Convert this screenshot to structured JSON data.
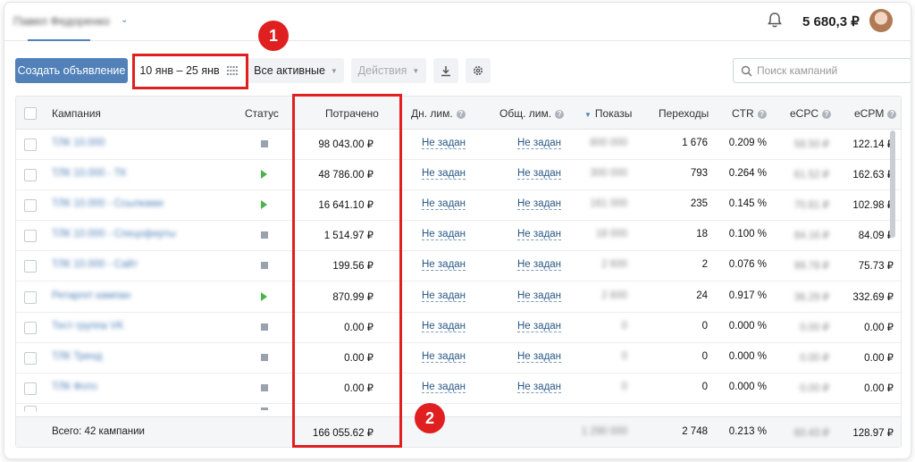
{
  "header": {
    "account_name": "Павел Федоренко",
    "balance": "5 680,3 ₽"
  },
  "toolbar": {
    "create_label": "Создать объявление",
    "date_range": "10 янв – 25 янв",
    "filter_label": "Все активные",
    "actions_label": "Действия",
    "search_placeholder": "Поиск кампаний"
  },
  "table": {
    "columns": {
      "campaign": "Кампания",
      "status": "Статус",
      "spent": "Потрачено",
      "daily_limit": "Дн. лим.",
      "total_limit": "Общ. лим.",
      "impressions": "Показы",
      "clicks": "Переходы",
      "ctr": "CTR",
      "ecpc": "eCPC",
      "ecpm": "eCPM"
    },
    "rows": [
      {
        "name": "ТЛК 10.000",
        "status": "paused",
        "spent": "98 043.00 ₽",
        "daily": "Не задан",
        "total": "Не задан",
        "impressions": "800 000",
        "clicks": "1 676",
        "ctr": "0.209 %",
        "ecpc": "58.50 ₽",
        "ecpm": "122.14 ₽"
      },
      {
        "name": "ТЛК 10.000 - ТК",
        "status": "active",
        "spent": "48 786.00 ₽",
        "daily": "Не задан",
        "total": "Не задан",
        "impressions": "300 000",
        "clicks": "793",
        "ctr": "0.264 %",
        "ecpc": "61.52 ₽",
        "ecpm": "162.63 ₽"
      },
      {
        "name": "ТЛК 10.000 - Ссылками",
        "status": "active",
        "spent": "16 641.10 ₽",
        "daily": "Не задан",
        "total": "Не задан",
        "impressions": "161 000",
        "clicks": "235",
        "ctr": "0.145 %",
        "ecpc": "70.81 ₽",
        "ecpm": "102.98 ₽"
      },
      {
        "name": "ТЛК 10.000 - Спецоферты",
        "status": "paused",
        "spent": "1 514.97 ₽",
        "daily": "Не задан",
        "total": "Не задан",
        "impressions": "18 000",
        "clicks": "18",
        "ctr": "0.100 %",
        "ecpc": "84.16 ₽",
        "ecpm": "84.09 ₽"
      },
      {
        "name": "ТЛК 10.000 - Сайт",
        "status": "paused",
        "spent": "199.56 ₽",
        "daily": "Не задан",
        "total": "Не задан",
        "impressions": "2 600",
        "clicks": "2",
        "ctr": "0.076 %",
        "ecpc": "99.78 ₽",
        "ecpm": "75.73 ₽"
      },
      {
        "name": "Ретаргет кампан",
        "status": "active",
        "spent": "870.99 ₽",
        "daily": "Не задан",
        "total": "Не задан",
        "impressions": "2 600",
        "clicks": "24",
        "ctr": "0.917 %",
        "ecpc": "36.29 ₽",
        "ecpm": "332.69 ₽"
      },
      {
        "name": "Тест группа VK",
        "status": "paused",
        "spent": "0.00 ₽",
        "daily": "Не задан",
        "total": "Не задан",
        "impressions": "0",
        "clicks": "0",
        "ctr": "0.000 %",
        "ecpc": "0.00 ₽",
        "ecpm": "0.00 ₽"
      },
      {
        "name": "ТЛК Тренд",
        "status": "paused",
        "spent": "0.00 ₽",
        "daily": "Не задан",
        "total": "Не задан",
        "impressions": "0",
        "clicks": "0",
        "ctr": "0.000 %",
        "ecpc": "0.00 ₽",
        "ecpm": "0.00 ₽"
      },
      {
        "name": "ТЛК Фото",
        "status": "paused",
        "spent": "0.00 ₽",
        "daily": "Не задан",
        "total": "Не задан",
        "impressions": "0",
        "clicks": "0",
        "ctr": "0.000 %",
        "ecpc": "0.00 ₽",
        "ecpm": "0.00 ₽"
      }
    ],
    "footer": {
      "label": "Всего: 42 кампании",
      "spent": "166 055.62 ₽",
      "impressions": "1 290 000",
      "clicks": "2 748",
      "ctr": "0.213 %",
      "ecpc": "60.43 ₽",
      "ecpm": "128.97 ₽"
    }
  },
  "annotations": {
    "badge_1": "1",
    "badge_2": "2",
    "highlight_color": "#e02020"
  }
}
